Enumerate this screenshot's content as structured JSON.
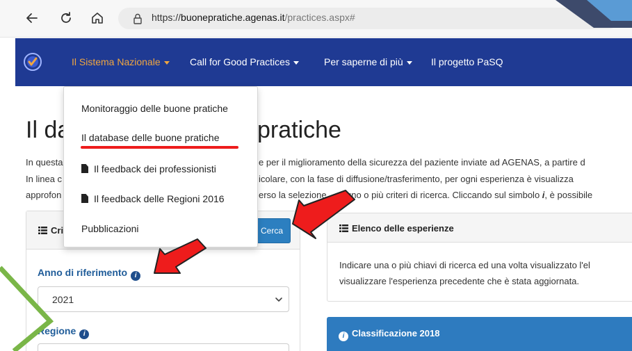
{
  "browser": {
    "url_prefix": "https://",
    "url_domain": "buonepratiche.agenas.it",
    "url_path": "/practices.aspx#"
  },
  "navbar": {
    "items": [
      {
        "label": "Il Sistema Nazionale",
        "active": true
      },
      {
        "label": "Call for Good Practices",
        "active": false
      },
      {
        "label": "Per saperne di più",
        "active": false
      },
      {
        "label": "Il progetto PaSQ",
        "active": false
      }
    ],
    "accent_color": "#f0a640",
    "bg_color": "#1f3a93"
  },
  "dropdown": {
    "items": [
      {
        "label": "Monitoraggio delle buone pratiche",
        "icon": ""
      },
      {
        "label": "Il database delle buone pratiche",
        "icon": ""
      },
      {
        "label": "Il feedback dei professionisti",
        "icon": "document-icon"
      },
      {
        "label": "Il feedback delle Regioni 2016",
        "icon": "document-icon"
      },
      {
        "label": "Pubblicazioni",
        "icon": ""
      }
    ]
  },
  "page": {
    "title_left": "Il da",
    "title_right": "pratiche",
    "intro_lines": [
      {
        "left": "In questa",
        "right": "e per il miglioramento della sicurezza del paziente inviate ad AGENAS, a partire d"
      },
      {
        "left": "In linea c",
        "right": "icolare, con la fase di diffusione/trasferimento, per ogni esperienza è visualizza"
      },
      {
        "left": "approfon",
        "right": "erso la selezione",
        "right2": "uno o più criteri di ricerca. Cliccando sul simbolo ",
        "emph": "i",
        "right3": ", è possibile"
      }
    ]
  },
  "left_panel": {
    "header_fragment": "Cri",
    "search_button": "Cerca",
    "anno_label": "Anno di riferimento",
    "anno_value": "2021",
    "regione_label": "Regione"
  },
  "right_panel": {
    "header": "Elenco delle esperienze",
    "body_lines": [
      "Indicare una o più chiavi di ricerca ed una volta visualizzato l'el",
      "visualizzare l'esperienza precedente che è stata aggiornata."
    ]
  },
  "classification_panel": {
    "header": "Classificazione 2018"
  }
}
